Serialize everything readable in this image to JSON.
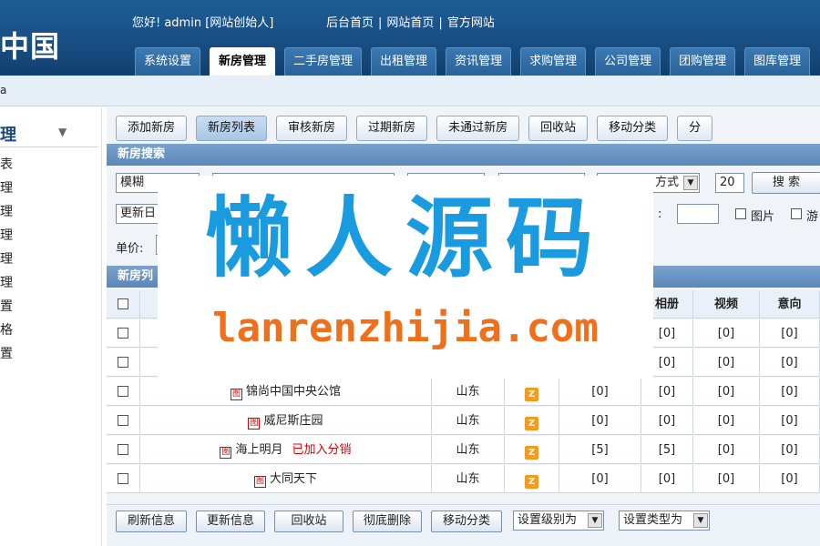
{
  "header": {
    "logo_text": "中国",
    "greeting": "您好! admin [网站创始人]",
    "top_links": [
      "后台首页",
      "网站首页",
      "官方网站"
    ],
    "link_separator": "|",
    "nav_tabs": [
      "系统设置",
      "新房管理",
      "二手房管理",
      "出租管理",
      "资讯管理",
      "求购管理",
      "公司管理",
      "团购管理",
      "图库管理"
    ],
    "active_tab": "新房管理"
  },
  "subbar": {
    "text": "a"
  },
  "sidebar": {
    "title": "理",
    "arrow_icon": "chevron-down-icon",
    "items": [
      "表",
      "理",
      "理",
      "理",
      "理",
      "理",
      "置",
      "格",
      "置"
    ]
  },
  "subtabs": [
    "添加新房",
    "新房列表",
    "审核新房",
    "过期新房",
    "未通过新房",
    "回收站",
    "移动分类",
    "分"
  ],
  "active_subtab": "新房列表",
  "search": {
    "section_title": "新房搜索",
    "fuzzy_select": "模糊",
    "sort_select": "方式",
    "page_size": "20",
    "search_button": "搜 索",
    "update_select": "更新日",
    "colon_label": ":",
    "image_checkbox_label": "图片",
    "tour_checkbox_label": "游",
    "price_label": "单价:"
  },
  "list": {
    "section_title": "新房列",
    "headers": {
      "album": "相册",
      "video": "视频",
      "intent": "意向"
    },
    "rows": [
      {
        "name": "",
        "region": "",
        "z": false,
        "c1": "",
        "album": "[0]",
        "video": "[0]",
        "intent": "[0]",
        "tag": ""
      },
      {
        "name": "",
        "region": "",
        "z": false,
        "c1": "",
        "album": "[0]",
        "video": "[0]",
        "intent": "[0]",
        "tag": ""
      },
      {
        "name": "锦尚中国中央公馆",
        "region": "山东",
        "z": true,
        "c1": "[0]",
        "album": "[0]",
        "video": "[0]",
        "intent": "[0]",
        "tag": ""
      },
      {
        "name": "威尼斯庄园",
        "region": "山东",
        "z": true,
        "c1": "[0]",
        "album": "[0]",
        "video": "[0]",
        "intent": "[0]",
        "tag": ""
      },
      {
        "name": "海上明月",
        "region": "山东",
        "z": true,
        "c1": "[5]",
        "album": "[5]",
        "video": "[0]",
        "intent": "[0]",
        "tag": "已加入分销"
      },
      {
        "name": "大同天下",
        "region": "山东",
        "z": true,
        "c1": "[0]",
        "album": "[0]",
        "video": "[0]",
        "intent": "[0]",
        "tag": ""
      }
    ],
    "row_icon_glyph": "图",
    "z_icon_glyph": "Z"
  },
  "bottom": {
    "buttons": [
      "刷新信息",
      "更新信息",
      "回收站",
      "彻底删除",
      "移动分类"
    ],
    "select_level": "设置级别为",
    "select_type": "设置类型为"
  },
  "watermark": {
    "cn": "懒人源码",
    "en": "lanrenzhijia.com"
  },
  "colors": {
    "header_blue": "#1f5d96",
    "watermark_blue": "#1a9be0",
    "watermark_orange": "#ef6f1a",
    "accent_red": "#e00000"
  }
}
